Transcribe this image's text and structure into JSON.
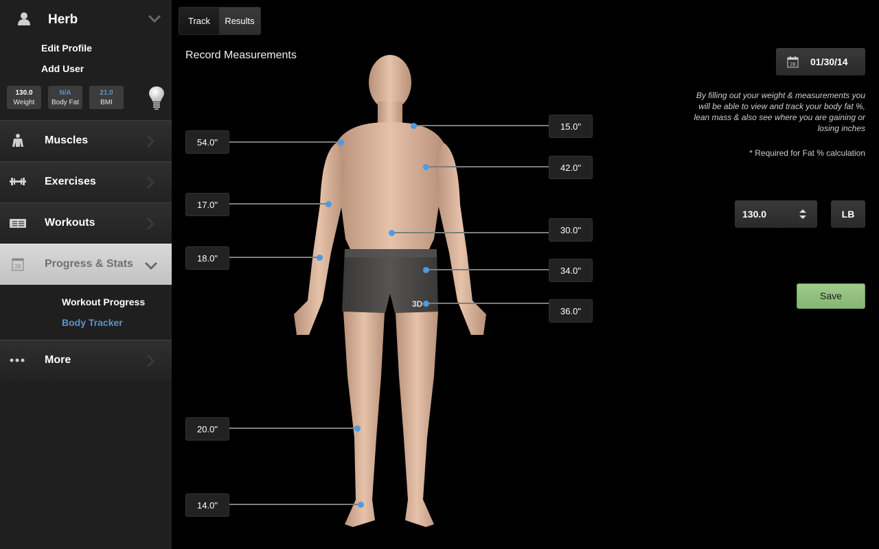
{
  "profile": {
    "user_name": "Herb",
    "edit_profile": "Edit Profile",
    "add_user": "Add User",
    "stats": [
      {
        "value": "130.0",
        "label": "Weight"
      },
      {
        "value": "N/A",
        "label": "Body Fat"
      },
      {
        "value": "21.0",
        "label": "BMI"
      }
    ]
  },
  "nav": {
    "items": [
      {
        "label": "Muscles",
        "icon": "muscles-icon"
      },
      {
        "label": "Exercises",
        "icon": "dumbbell-icon"
      },
      {
        "label": "Workouts",
        "icon": "workouts-icon"
      },
      {
        "label": "Progress & Stats",
        "icon": "calendar-icon",
        "calendar_day": "28"
      },
      {
        "label": "More",
        "icon": "more-icon"
      }
    ],
    "progress_sub": [
      {
        "label": "Workout Progress"
      },
      {
        "label": "Body Tracker"
      }
    ]
  },
  "tabs": [
    {
      "label": "Track"
    },
    {
      "label": "Results"
    }
  ],
  "main": {
    "title": "Record Measurements",
    "measurements_left": [
      {
        "value": "54.0\""
      },
      {
        "value": "17.0\""
      },
      {
        "value": "18.0\""
      },
      {
        "value": "20.0\""
      },
      {
        "value": "14.0\""
      }
    ],
    "measurements_right": [
      {
        "value": "15.0\""
      },
      {
        "value": "42.0\""
      },
      {
        "value": "30.0\""
      },
      {
        "value": "34.0\""
      },
      {
        "value": "36.0\""
      }
    ],
    "figure_brand": "3D"
  },
  "right_panel": {
    "date": "01/30/14",
    "calendar_day": "28",
    "info_text": "By filling out your weight & measurements you will be able to view and track your body fat %, lean mass & also see where you are gaining or losing inches",
    "required_note": "* Required for Fat % calculation",
    "weight_value": "130.0",
    "unit": "LB",
    "save_label": "Save"
  },
  "colors": {
    "accent_blue": "#5f93c4",
    "marker_blue": "#4d9be0",
    "save_green": "#93c080",
    "sidebar_bg": "#1f1f1f"
  }
}
